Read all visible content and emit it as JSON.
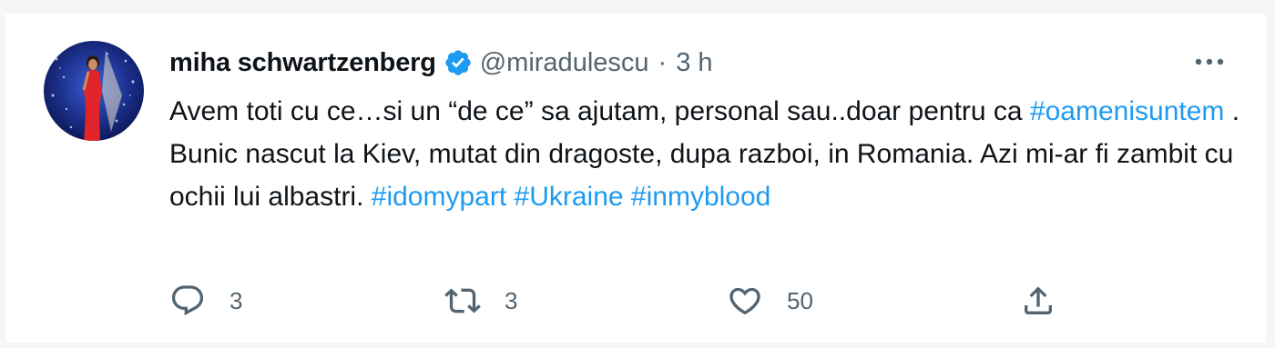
{
  "tweet": {
    "author_name": "miha schwartzenberg",
    "handle": "@miradulescu",
    "separator": "·",
    "time": "3 h",
    "text_parts": [
      {
        "text": "Avem toti cu ce…si un “de ce” sa ajutam, personal sau..doar pentru ca ",
        "type": "text"
      },
      {
        "text": "#oamenisuntem",
        "type": "hashtag"
      },
      {
        "text": " . Bunic nascut la Kiev, mutat din dragoste, dupa razboi, in Romania. Azi mi-ar fi zambit cu ochii lui albastri. ",
        "type": "text"
      },
      {
        "text": "#idomypart",
        "type": "hashtag"
      },
      {
        "text": " ",
        "type": "text"
      },
      {
        "text": "#Ukraine",
        "type": "hashtag"
      },
      {
        "text": " ",
        "type": "text"
      },
      {
        "text": "#inmyblood",
        "type": "hashtag"
      }
    ],
    "counts": {
      "replies": "3",
      "retweets": "3",
      "likes": "50"
    }
  },
  "icons": {
    "verified": "verified-badge-icon",
    "more": "more-dots-icon",
    "reply": "reply-icon",
    "retweet": "retweet-icon",
    "like": "heart-icon",
    "share": "share-icon"
  },
  "colors": {
    "link": "#1d9bf0",
    "text": "#0f1419",
    "secondary": "#536471",
    "verified": "#1d9bf0"
  }
}
